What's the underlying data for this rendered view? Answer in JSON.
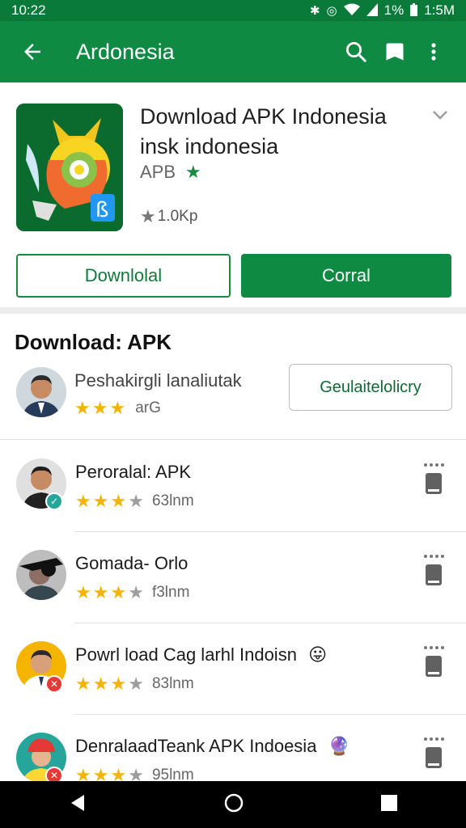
{
  "status_bar": {
    "time": "10:22",
    "battery": "1%",
    "clock_right": "1:5M"
  },
  "app_bar": {
    "title": "Ardonesia",
    "icons": [
      "back-arrow-icon",
      "search-icon",
      "bookmark-icon",
      "overflow-menu-icon"
    ]
  },
  "app": {
    "name_line1": "Download APK Indonesia",
    "name_line2": "insk indonesia",
    "developer": "APB",
    "rating_text": "1.0Kp",
    "buttons": {
      "outline": "Downlolal",
      "filled": "Corral"
    }
  },
  "section": {
    "title": "Download: APK",
    "item": {
      "name": "Peshakirgli lanaliutak",
      "stars_on": 3,
      "rating_text": "arG",
      "button": "Geulaitelolicry"
    }
  },
  "list": [
    {
      "title": "Peroralal: APK",
      "stars_on": 3,
      "stars_off": 1,
      "meta": "63lnm",
      "badge_color": "#26a69a",
      "badge_icon": "wrench-icon",
      "badge_glyph": "✓"
    },
    {
      "title": "Gomada- Orlo",
      "stars_on": 3,
      "stars_off": 1,
      "meta": "f3lnm",
      "badge_color": "",
      "badge_icon": "",
      "badge_glyph": ""
    },
    {
      "title": "Powrl load Cag larhl Indoisn",
      "emoji": "😛",
      "stars_on": 3,
      "stars_off": 1,
      "meta": "83lnm",
      "badge_color": "#e53935",
      "badge_icon": "tool-icon",
      "badge_glyph": "✕"
    },
    {
      "title": "DenralaadTeank APK Indoesia",
      "emoji": "🔮",
      "stars_on": 3,
      "stars_off": 1,
      "meta": "95lnm",
      "badge_color": "#e53935",
      "badge_icon": "tool-icon",
      "badge_glyph": "✕"
    }
  ],
  "colors": {
    "primary": "#0f8a43",
    "status": "#0a7a3a",
    "star": "#f4b400"
  }
}
